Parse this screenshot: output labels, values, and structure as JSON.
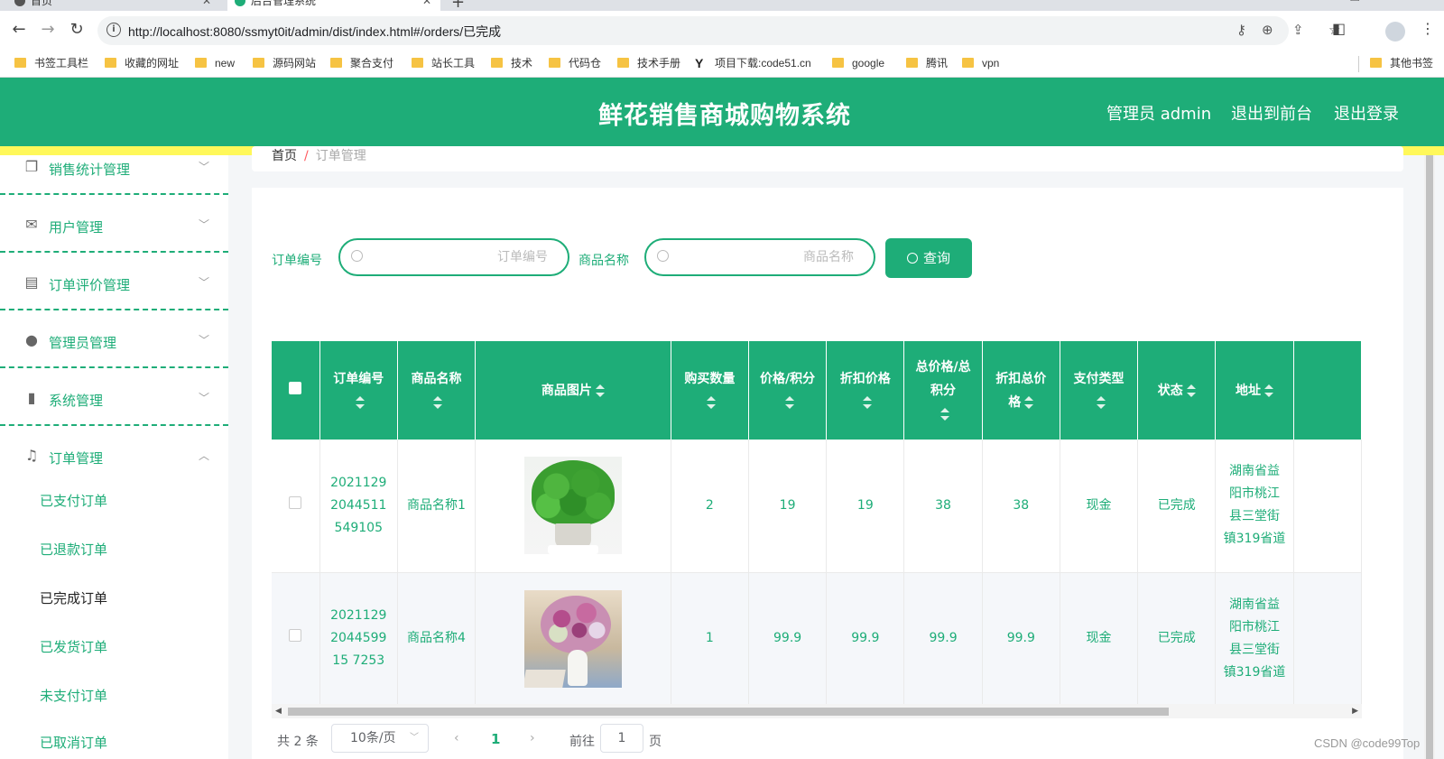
{
  "browser": {
    "tabs": [
      {
        "label": "首页"
      },
      {
        "label": "后台管理系统"
      }
    ],
    "url": "http://localhost:8080/ssmyt0it/admin/dist/index.html#/orders/已完成",
    "bookmarks": [
      {
        "label": "书签工具栏"
      },
      {
        "label": "收藏的网址"
      },
      {
        "label": "new"
      },
      {
        "label": "源码网站"
      },
      {
        "label": "聚合支付"
      },
      {
        "label": "站长工具"
      },
      {
        "label": "技术"
      },
      {
        "label": "代码仓"
      },
      {
        "label": "技术手册"
      },
      {
        "label": "项目下载:code51.cn"
      },
      {
        "label": "google"
      },
      {
        "label": "腾讯"
      },
      {
        "label": "vpn"
      }
    ],
    "other_bookmarks": "其他书签"
  },
  "header": {
    "title": "鲜花销售商城购物系统",
    "admin_label": "管理员 admin",
    "to_front": "退出到前台",
    "logout": "退出登录"
  },
  "sidebar": {
    "menus": [
      {
        "label": "销售统计管理",
        "icon": "copy-icon"
      },
      {
        "label": "用户管理",
        "icon": "mail-icon"
      },
      {
        "label": "订单评价管理",
        "icon": "clipboard-icon"
      },
      {
        "label": "管理员管理",
        "icon": "user-icon"
      },
      {
        "label": "系统管理",
        "icon": "bar-chart-icon"
      },
      {
        "label": "订单管理",
        "icon": "bell-off-icon"
      }
    ],
    "submenu": [
      {
        "label": "已支付订单"
      },
      {
        "label": "已退款订单"
      },
      {
        "label": "已完成订单"
      },
      {
        "label": "已发货订单"
      },
      {
        "label": "未支付订单"
      },
      {
        "label": "已取消订单"
      }
    ]
  },
  "breadcrumb": {
    "home": "首页",
    "separator": "/",
    "current": "订单管理"
  },
  "filters": {
    "order_no_label": "订单编号",
    "order_no_placeholder": "订单编号",
    "product_name_label": "商品名称",
    "product_name_placeholder": "商品名称",
    "query_button": "查询"
  },
  "table": {
    "headers": [
      "订单编号",
      "商品名称",
      "商品图片",
      "购买数量",
      "价格/积分",
      "折扣价格",
      "总价格/总积分",
      "折扣总价格",
      "支付类型",
      "状态",
      "地址"
    ],
    "rows": [
      {
        "order_no": "20211292044511549105",
        "product_name": "商品名称1",
        "image": "green-potted-plant",
        "qty": "2",
        "price": "19",
        "discount_price": "19",
        "total": "38",
        "discount_total": "38",
        "pay_type": "现金",
        "status": "已完成",
        "address": "湖南省益阳市桃江县三堂街镇319省道"
      },
      {
        "order_no": "2021129204459915 7253",
        "product_name": "商品名称4",
        "image": "pink-flower-bouquet",
        "qty": "1",
        "price": "99.9",
        "discount_price": "99.9",
        "total": "99.9",
        "discount_total": "99.9",
        "pay_type": "现金",
        "status": "已完成",
        "address": "湖南省益阳市桃江县三堂街镇319省道"
      }
    ]
  },
  "pagination": {
    "total_text": "共 2 条",
    "page_size": "10条/页",
    "current_page": "1",
    "goto_label": "前往",
    "goto_value": "1",
    "page_suffix": "页"
  },
  "watermark": "CSDN @code99Top",
  "colors": {
    "primary": "#1ead78",
    "accent_bar": "#fff85a"
  }
}
